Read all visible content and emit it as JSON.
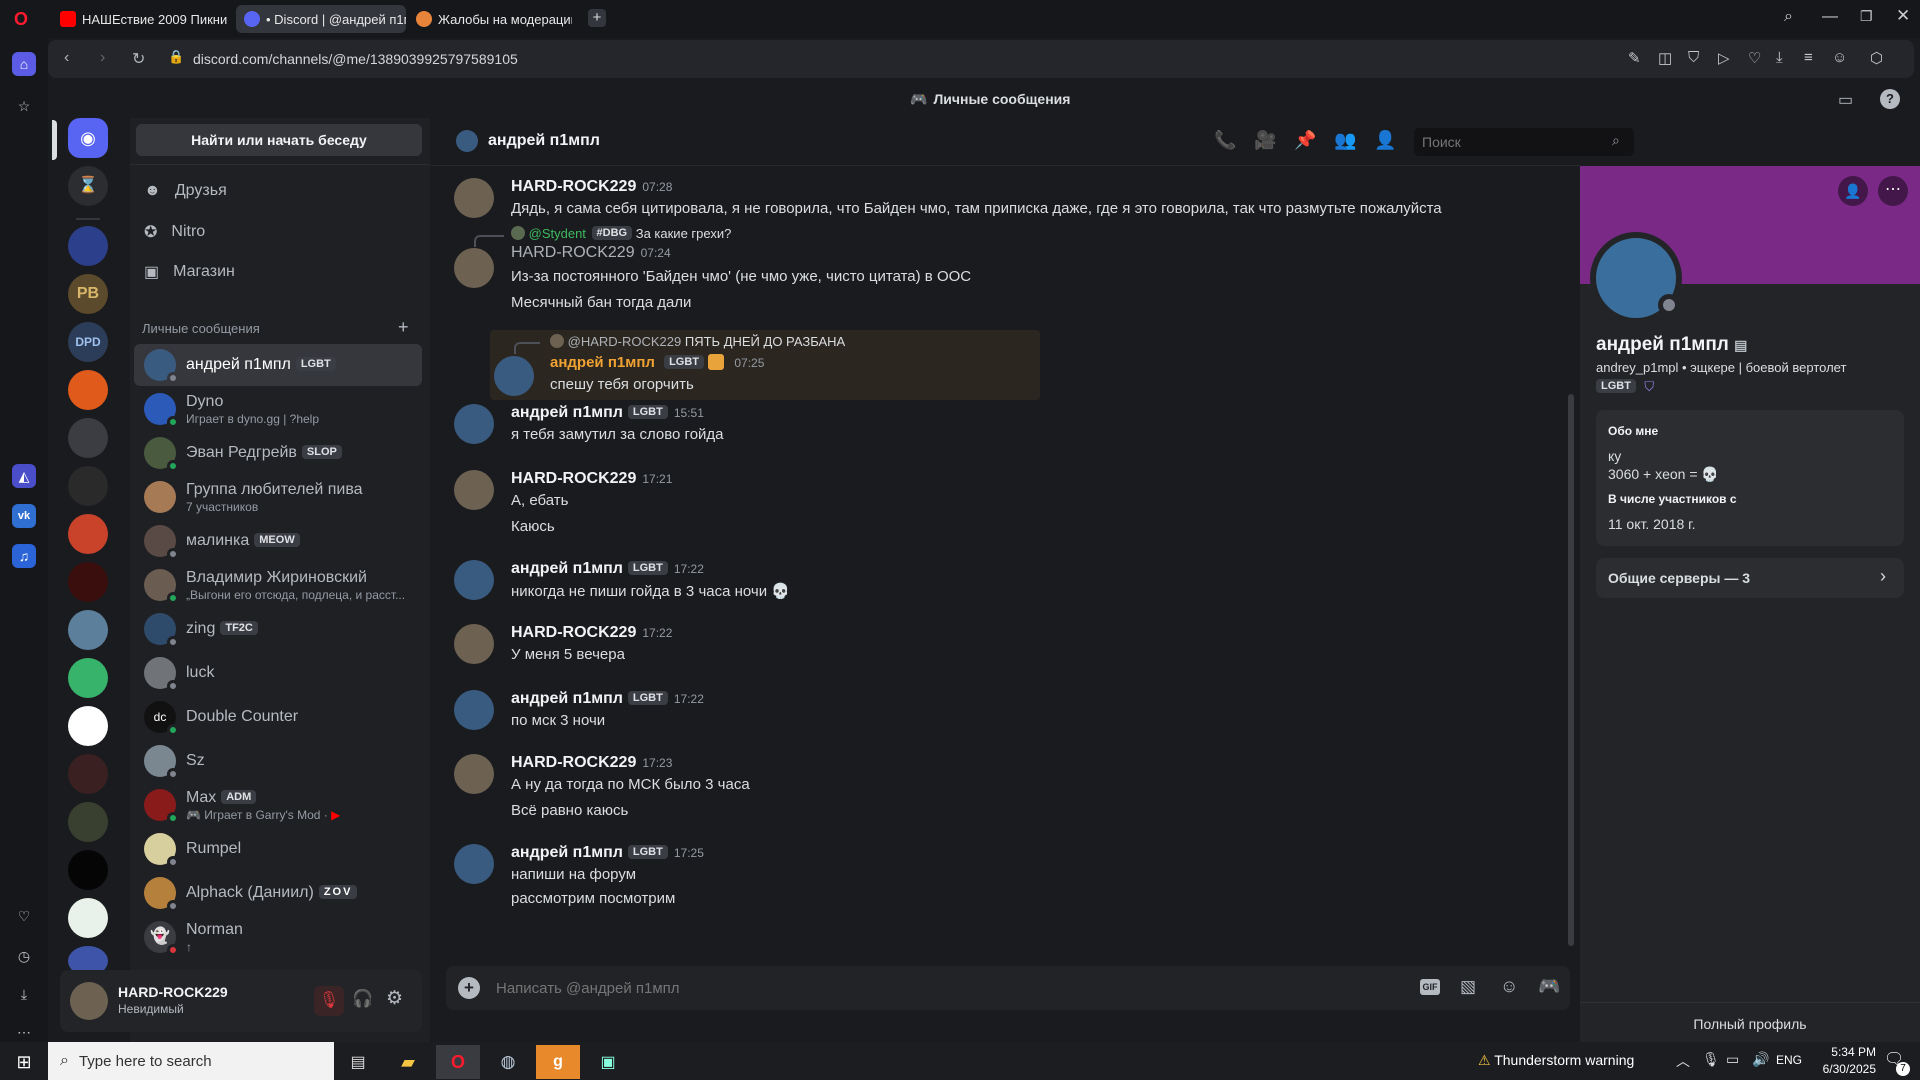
{
  "browser": {
    "tabs": [
      {
        "label": "НАШЕствие 2009 Пикник"
      },
      {
        "label": "• Discord | @андрей п1мпл"
      },
      {
        "label": "Жалобы на модерацию"
      }
    ],
    "url": "discord.com/channels/@me/1389039925797589105"
  },
  "discord": {
    "strip_title": "Личные сообщения",
    "find_button": "Найти или начать беседу",
    "nav": [
      {
        "label": "Друзья",
        "icon": "friends-icon"
      },
      {
        "label": "Nitro",
        "icon": "nitro-icon"
      },
      {
        "label": "Магазин",
        "icon": "shop-icon"
      }
    ],
    "dm_header": "Личные сообщения",
    "dms": [
      {
        "name": "андрей п1мпл",
        "tag": "LGBT",
        "sub": ""
      },
      {
        "name": "Dyno",
        "tag": "",
        "sub": "Играет в dyno.gg | ?help"
      },
      {
        "name": "Эван Редгрейв",
        "tag": "SLOP",
        "sub": ""
      },
      {
        "name": "Группа любителей пива",
        "tag": "",
        "sub": "7 участников"
      },
      {
        "name": "малинка",
        "tag": "MEOW",
        "sub": ""
      },
      {
        "name": "Владимир Жириновский",
        "tag": "",
        "sub": "„Выгони его отсюда, подлеца, и расст..."
      },
      {
        "name": "zing",
        "tag": "TF2C",
        "sub": ""
      },
      {
        "name": "luck",
        "tag": "",
        "sub": ""
      },
      {
        "name": "Double Counter",
        "tag": "",
        "sub": ""
      },
      {
        "name": "Sz",
        "tag": "",
        "sub": ""
      },
      {
        "name": "Max",
        "tag": "ADM",
        "sub": "Играет в Garry's Mod ·"
      },
      {
        "name": "Rumpel",
        "tag": "",
        "sub": ""
      },
      {
        "name": "Alphack (Даниил)",
        "tag": "ZOV",
        "sub": ""
      },
      {
        "name": "Norman",
        "tag": "",
        "sub": "↑"
      }
    ],
    "me": {
      "name": "HARD-ROCK229",
      "status": "Невидимый"
    },
    "chat": {
      "title": "андрей п1мпл",
      "search_placeholder": "Поиск",
      "input_placeholder": "Написать @андрей п1мпл",
      "messages": [
        {
          "author": "HARD-ROCK229",
          "time": "07:28",
          "lines": [
            "Дядь, я сама себя цитировала, я не говорила, что Байден чмо, там приписка даже, где я это говорила, так что размутьте пожалуйста"
          ]
        },
        {
          "reply_author": "@Stydent",
          "reply_tag": "#DBG",
          "reply_text": "За какие грехи?",
          "author": "HARD-ROCK229",
          "time": "07:24",
          "lines": [
            "Из-за постоянного 'Байден чмо' (не чмо уже, чисто цитата) в ООС",
            "Месячный бан тогда дали"
          ]
        },
        {
          "reply_author": "@HARD-ROCK229",
          "reply_text": "ПЯТЬ ДНЕЙ ДО РАЗБАНА",
          "author": "андрей п1мпл",
          "tag": "LGBT",
          "time": "07:25",
          "lines": [
            "спешу тебя огорчить"
          ]
        },
        {
          "author": "андрей п1мпл",
          "tag": "LGBT",
          "time": "15:51",
          "lines": [
            "я тебя замутил за слово гойда"
          ]
        },
        {
          "author": "HARD-ROCK229",
          "time": "17:21",
          "lines": [
            "А, ебать",
            "Каюсь"
          ]
        },
        {
          "author": "андрей п1мпл",
          "tag": "LGBT",
          "time": "17:22",
          "lines": [
            "никогда не пиши гойда в 3 часа ночи 💀"
          ]
        },
        {
          "author": "HARD-ROCK229",
          "time": "17:22",
          "lines": [
            "У меня 5 вечера"
          ]
        },
        {
          "author": "андрей п1мпл",
          "tag": "LGBT",
          "time": "17:22",
          "lines": [
            "по мск 3 ночи"
          ]
        },
        {
          "author": "HARD-ROCK229",
          "time": "17:23",
          "lines": [
            "А ну да тогда по МСК было 3 часа",
            "Всё равно каюсь"
          ]
        },
        {
          "author": "андрей п1мпл",
          "tag": "LGBT",
          "time": "17:25",
          "lines": [
            "напиши на форум",
            "рассмотрим посмотрим"
          ]
        }
      ]
    },
    "profile": {
      "name": "андрей п1мпл",
      "handle": "andrey_p1mpl • эщкере | боевой вертолет",
      "tag": "LGBT",
      "about_title": "Обо мне",
      "about_lines": [
        "ку",
        "3060 + xeon = 💀"
      ],
      "member_title": "В числе участников с",
      "member_since": "11 окт. 2018 г.",
      "mutual": "Общие серверы — 3",
      "full": "Полный профиль"
    }
  },
  "taskbar": {
    "search": "Type here to search",
    "weather": "Thunderstorm warning",
    "lang": "ENG",
    "time": "5:34 PM",
    "date": "6/30/2025",
    "notif": "7"
  },
  "colors": {
    "accent": "#5865f2",
    "banner": "#7a2a86",
    "online": "#23a55a",
    "idle": "#80848e",
    "red": "#da373c"
  }
}
